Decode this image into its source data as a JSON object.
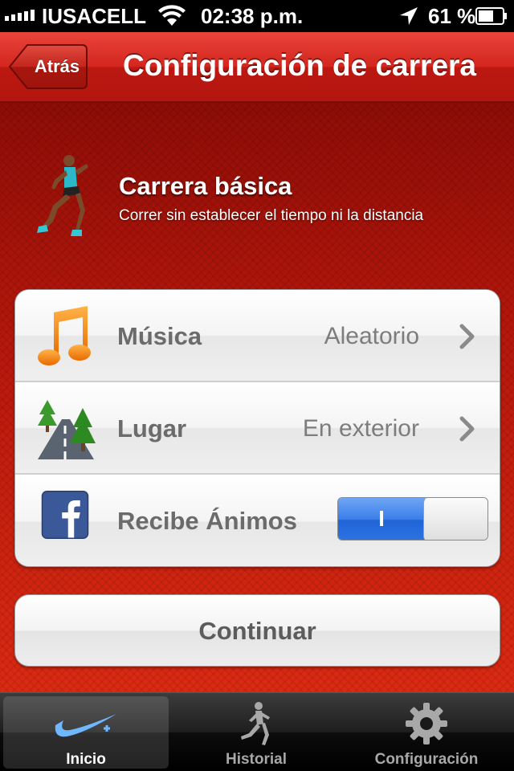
{
  "status_bar": {
    "carrier": "IUSACELL",
    "time": "02:38 p.m.",
    "battery": "61 %"
  },
  "nav": {
    "back_label": "Atrás",
    "title": "Configuración de carrera"
  },
  "run": {
    "title": "Carrera básica",
    "subtitle": "Correr sin establecer el tiempo ni la distancia"
  },
  "settings": [
    {
      "label": "Música",
      "value": "Aleatorio",
      "icon": "music-note-icon"
    },
    {
      "label": "Lugar",
      "value": "En exterior",
      "icon": "outdoor-road-trees-icon"
    },
    {
      "label": "Recibe Ánimos",
      "icon": "facebook-icon",
      "toggle_on": true,
      "toggle_text": "I"
    }
  ],
  "continue_label": "Continuar",
  "tabs": [
    {
      "label": "Inicio",
      "icon": "nike-swoosh-icon",
      "active": true
    },
    {
      "label": "Historial",
      "icon": "runner-silhouette-icon",
      "active": false
    },
    {
      "label": "Configuración",
      "icon": "gear-icon",
      "active": false
    }
  ],
  "colors": {
    "nav_red": "#d3261e",
    "background_red": "#c01a10",
    "toggle_blue": "#3a7ee9",
    "music_orange": "#f07a10"
  }
}
